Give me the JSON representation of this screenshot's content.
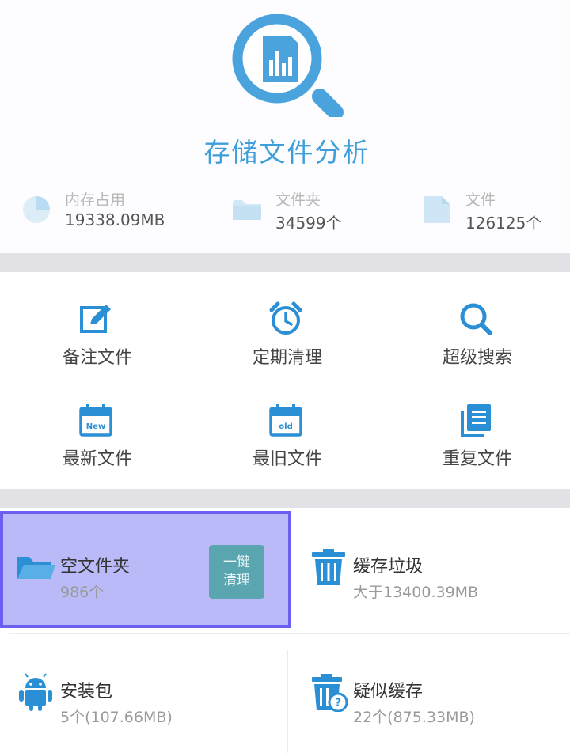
{
  "app": {
    "title": "存储文件分析"
  },
  "stats": [
    {
      "label": "内存占用",
      "value": "19338.09MB",
      "icon": "pie-chart-icon"
    },
    {
      "label": "文件夹",
      "value": "34599个",
      "icon": "folder-icon"
    },
    {
      "label": "文件",
      "value": "126125个",
      "icon": "file-icon"
    }
  ],
  "grid": [
    {
      "label": "备注文件",
      "icon": "edit-note-icon"
    },
    {
      "label": "定期清理",
      "icon": "alarm-clock-icon"
    },
    {
      "label": "超级搜索",
      "icon": "search-icon"
    },
    {
      "label": "最新文件",
      "icon": "calendar-new-icon",
      "badge": "New"
    },
    {
      "label": "最旧文件",
      "icon": "calendar-old-icon",
      "badge": "old"
    },
    {
      "label": "重复文件",
      "icon": "duplicate-files-icon"
    }
  ],
  "tools": [
    {
      "name": "空文件夹",
      "sub": "986个",
      "icon": "open-folder-icon",
      "action": "一键\n清理"
    },
    {
      "name": "缓存垃圾",
      "sub": "大于13400.39MB",
      "icon": "trash-icon"
    },
    {
      "name": "安装包",
      "sub": "5个(107.66MB)",
      "icon": "android-icon"
    },
    {
      "name": "疑似缓存",
      "sub": "22个(875.33MB)",
      "icon": "trash-question-icon"
    }
  ],
  "colors": {
    "accent": "#3d9ed9",
    "icon_blue": "#2b8fd6",
    "stat_icon": "#c8e3f5",
    "highlight_fill": "#babaf8",
    "highlight_border": "#6a5ff0",
    "button_teal": "#5aa6b0"
  }
}
